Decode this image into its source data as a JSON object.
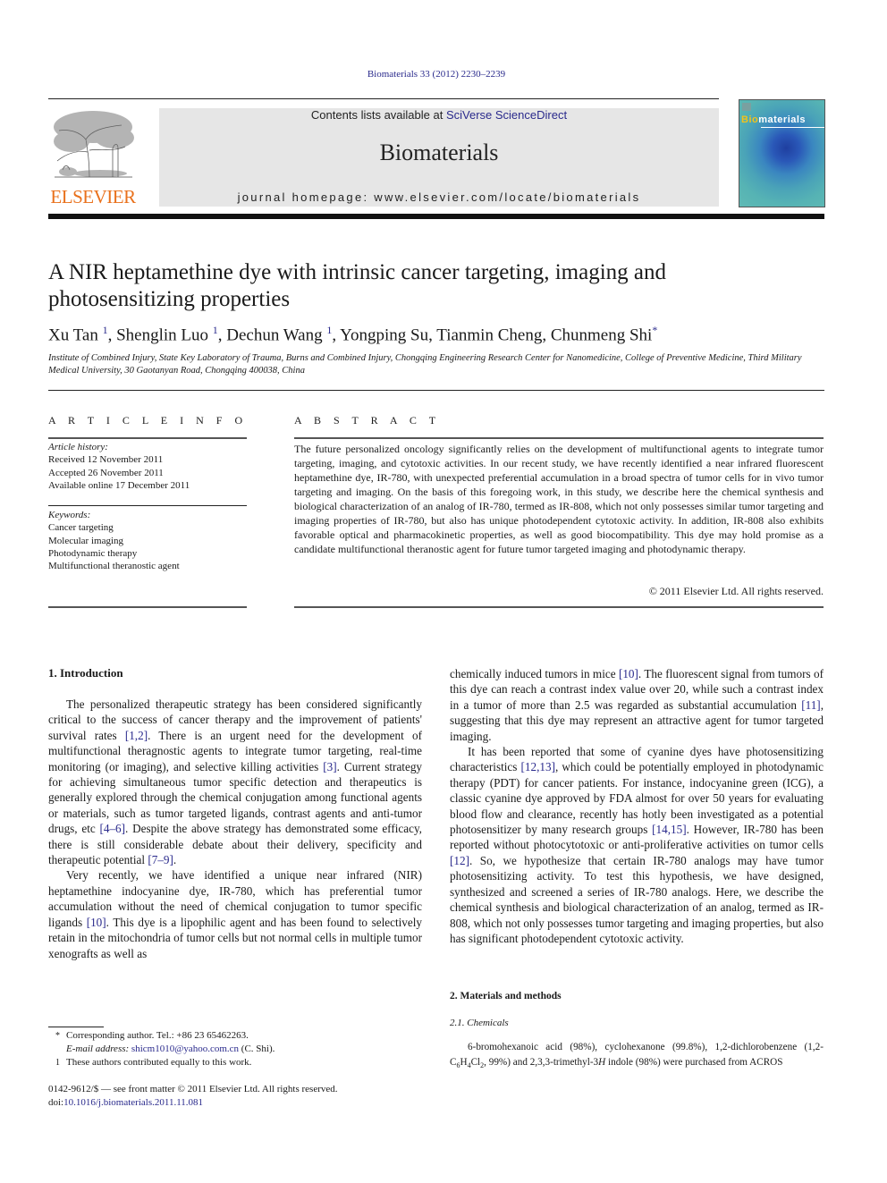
{
  "header": {
    "citation": "Biomaterials 33 (2012) 2230–2239",
    "contents_prefix": "Contents lists available at ",
    "contents_link": "SciVerse ScienceDirect",
    "journal_name": "Biomaterials",
    "homepage_prefix": "journal homepage: ",
    "homepage_url": "www.elsevier.com/locate/biomaterials",
    "publisher_logo_text": "ELSEVIER",
    "cover_title_highlight": "Bio",
    "cover_title_rest": "materials",
    "colors": {
      "link": "#2a2a8c",
      "elsevier_orange": "#e9711c",
      "masthead_bg": "#e6e6e6"
    }
  },
  "article": {
    "title": "A NIR heptamethine dye with intrinsic cancer targeting, imaging and photosensitizing properties",
    "authors": [
      {
        "name": "Xu Tan",
        "mark": "1"
      },
      {
        "name": "Shenglin Luo",
        "mark": "1"
      },
      {
        "name": "Dechun Wang",
        "mark": "1"
      },
      {
        "name": "Yongping Su",
        "mark": ""
      },
      {
        "name": "Tianmin Cheng",
        "mark": ""
      },
      {
        "name": "Chunmeng Shi",
        "mark": "*"
      }
    ],
    "affiliation": "Institute of Combined Injury, State Key Laboratory of Trauma, Burns and Combined Injury, Chongqing Engineering Research Center for Nanomedicine, College of Preventive Medicine, Third Military Medical University, 30 Gaotanyan Road, Chongqing 400038, China"
  },
  "article_info": {
    "label": "A R T I C L E   I N F O",
    "history_heading": "Article history:",
    "history": [
      "Received 12 November 2011",
      "Accepted 26 November 2011",
      "Available online 17 December 2011"
    ],
    "keywords_heading": "Keywords:",
    "keywords": [
      "Cancer targeting",
      "Molecular imaging",
      "Photodynamic therapy",
      "Multifunctional theranostic agent"
    ]
  },
  "abstract": {
    "label": "A B S T R A C T",
    "text": "The future personalized oncology significantly relies on the development of multifunctional agents to integrate tumor targeting, imaging, and cytotoxic activities. In our recent study, we have recently identified a near infrared fluorescent heptamethine dye, IR-780, with unexpected preferential accumulation in a broad spectra of tumor cells for in vivo tumor targeting and imaging. On the basis of this foregoing work, in this study, we describe here the chemical synthesis and biological characterization of an analog of IR-780, termed as IR-808, which not only possesses similar tumor targeting and imaging properties of IR-780, but also has unique photodependent cytotoxic activity. In addition, IR-808 also exhibits favorable optical and pharmacokinetic properties, as well as good biocompatibility. This dye may hold promise as a candidate multifunctional theranostic agent for future tumor targeted imaging and photodynamic therapy.",
    "copyright": "© 2011 Elsevier Ltd. All rights reserved."
  },
  "introduction": {
    "heading": "1.  Introduction",
    "p1": [
      "The personalized therapeutic strategy has been considered significantly critical to the success of cancer therapy and the improvement of patients' survival rates ",
      "[1,2]",
      ". There is an urgent need for the development of multifunctional theragnostic agents to integrate tumor targeting, real-time monitoring (or imaging), and selective killing activities ",
      "[3]",
      ". Current strategy for achieving simultaneous tumor specific detection and therapeutics is generally explored through the chemical conjugation among functional agents or materials, such as tumor targeted ligands, contrast agents and anti-tumor drugs, etc ",
      "[4–6]",
      ". Despite the above strategy has demonstrated some efficacy, there is still considerable debate about their delivery, specificity and therapeutic potential ",
      "[7–9]",
      "."
    ],
    "p2": [
      "Very recently, we have identified a unique near infrared (NIR) heptamethine indocyanine dye, IR-780, which has preferential tumor accumulation without the need of chemical conjugation to tumor specific ligands ",
      "[10]",
      ". This dye is a lipophilic agent and has been found to selectively retain in the mitochondria of tumor cells but not normal cells in multiple tumor xenografts as well as chemically induced tumors in mice ",
      "[10]",
      ". The fluorescent signal from tumors of this dye can reach a contrast index value over 20, while such a contrast index in a tumor of more than 2.5 was regarded as substantial accumulation ",
      "[11]",
      ", suggesting that this dye may represent an attractive agent for tumor targeted imaging."
    ],
    "p3": [
      "It has been reported that some of cyanine dyes have photosensitizing characteristics ",
      "[12,13]",
      ", which could be potentially employed in photodynamic therapy (PDT) for cancer patients. For instance, indocyanine green (ICG), a classic cyanine dye approved by FDA almost for over 50 years for evaluating blood flow and clearance, recently has hotly been investigated as a potential photosensitizer by many research groups ",
      "[14,15]",
      ". However, IR-780 has been reported without photocytotoxic or anti-proliferative activities on tumor cells ",
      "[12]",
      ". So, we hypothesize that certain IR-780 analogs may have tumor photosensitizing activity. To test this hypothesis, we have designed, synthesized and screened a series of IR-780 analogs. Here, we describe the chemical synthesis and biological characterization of an analog, termed as IR-808, which not only possesses tumor targeting and imaging properties, but also has significant photodependent cytotoxic activity."
    ]
  },
  "methods": {
    "heading": "2.  Materials and methods",
    "subheading": "2.1.  Chemicals",
    "text_a": "6-bromohexanoic acid (98%), cyclohexanone (99.8%), 1,2-dichlorobenzene (1,2-C",
    "sub1": "6",
    "text_b": "H",
    "sub2": "4",
    "text_c": "Cl",
    "sub3": "2",
    "text_d": ", 99%) and 2,3,3-trimethyl-3",
    "italic_h": "H",
    "text_e": " indole (98%) were purchased from ACROS"
  },
  "footnotes": {
    "corresponding_mark": "*",
    "corresponding_text": "Corresponding author. Tel.: +86 23 65462263.",
    "email_label": "E-mail address: ",
    "email": "shicm1010@yahoo.com.cn",
    "email_suffix": " (C. Shi).",
    "equal_mark": "1",
    "equal_text": "These authors contributed equally to this work.",
    "issn_line": "0142-9612/$ — see front matter © 2011 Elsevier Ltd. All rights reserved.",
    "doi_prefix": "doi:",
    "doi": "10.1016/j.biomaterials.2011.11.081"
  }
}
